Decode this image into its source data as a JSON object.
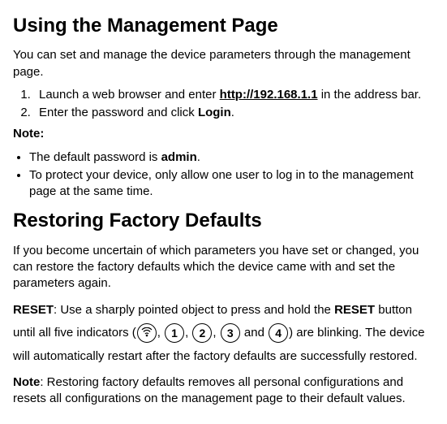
{
  "section1": {
    "heading": "Using the Management Page",
    "intro": "You can set and manage the device parameters through the management page.",
    "step1_a": "Launch a web browser and enter ",
    "step1_url": "http://192.168.1.1",
    "step1_b": " in the address bar.",
    "step2_a": "Enter the password and click ",
    "step2_b": "Login",
    "step2_c": ".",
    "note_label": "Note:",
    "bullet1_a": "The default password is ",
    "bullet1_b": "admin",
    "bullet1_c": ".",
    "bullet2": "To protect your device, only allow one user to log in to the management page at the same time."
  },
  "section2": {
    "heading": "Restoring Factory Defaults",
    "intro": "If you become uncertain of which parameters you have set or changed, you can restore the factory defaults which the device came with and set the parameters again.",
    "reset_label": "RESET",
    "reset_a": ": Use a sharply pointed object to press and hold the ",
    "reset_b": "RESET",
    "reset_c": " button until all five indicators (",
    "comma1": ", ",
    "comma2": ", ",
    "comma3": ", ",
    "and": " and ",
    "reset_d": ") are blinking. The device will automatically restart after the factory defaults are successfully restored.",
    "ind1": "1",
    "ind2": "2",
    "ind3": "3",
    "ind4": "4",
    "note_label": "Note",
    "note_text": ": Restoring factory defaults removes all personal configurations and resets all configurations on the management page to their default values."
  }
}
